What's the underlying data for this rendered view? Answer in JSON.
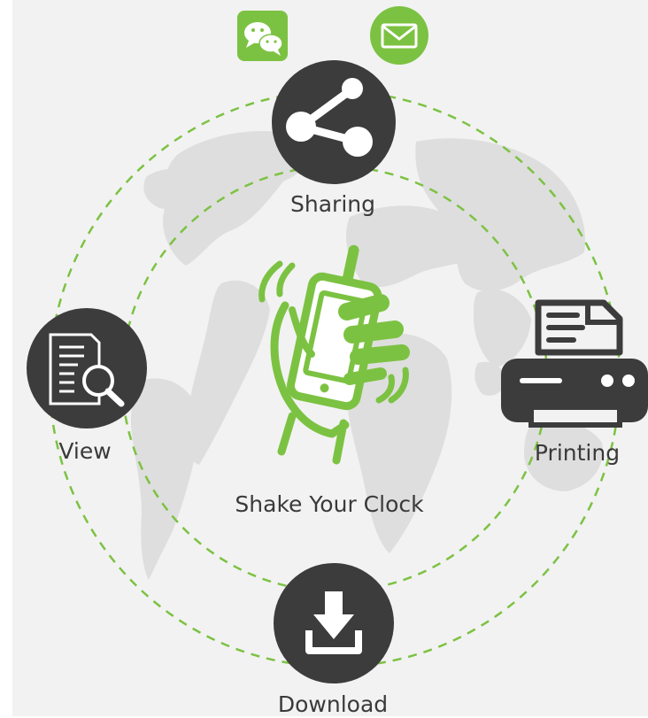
{
  "center": {
    "label": "Shake Your Clock",
    "icon": "shaking-phone-hand-icon"
  },
  "nodes": {
    "sharing": {
      "label": "Sharing",
      "icon": "share-icon"
    },
    "view": {
      "label": "View",
      "icon": "document-search-icon"
    },
    "printing": {
      "label": "Printing",
      "icon": "printer-icon"
    },
    "download": {
      "label": "Download",
      "icon": "download-icon"
    }
  },
  "apps": [
    {
      "name": "wechat",
      "icon": "wechat-icon"
    },
    {
      "name": "mail",
      "icon": "mail-icon"
    }
  ],
  "colors": {
    "accent_green": "#7cc242",
    "dark_circle": "#3c3c3c",
    "map_gray": "#dedede",
    "background": "#f2f2f2",
    "text": "#3a3a3a"
  }
}
